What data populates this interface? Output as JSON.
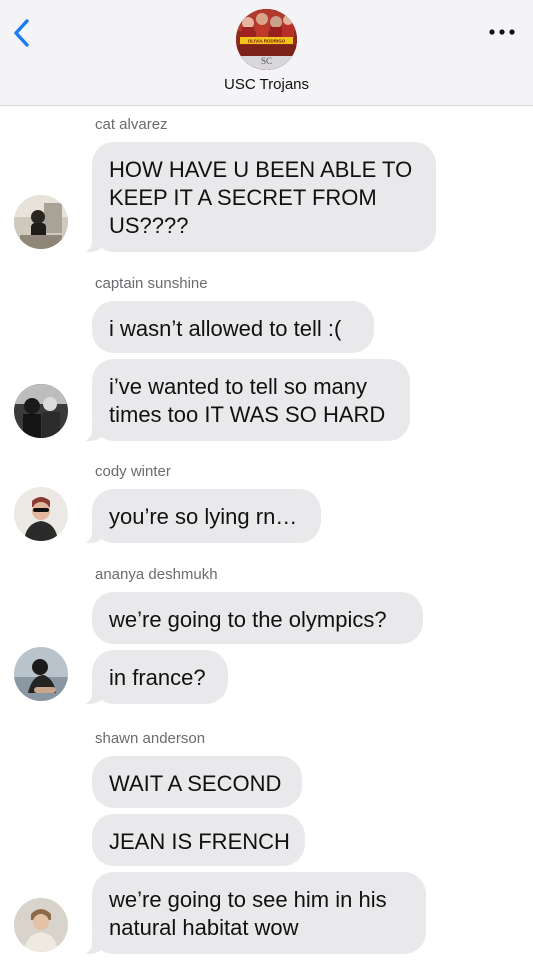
{
  "header": {
    "group_name": "USC Trojans",
    "group_avatar_text_top": "OLIVIA RODRIGO",
    "group_avatar_text_bottom": "SC",
    "back_icon": "chevron-left-icon",
    "more_icon": "ellipsis-icon",
    "accent_color": "#1a7cf5"
  },
  "messages": [
    {
      "sender": "cat alvarez",
      "bubbles": [
        [
          "HOW HAVE U BEEN ABLE TO",
          "KEEP IT A SECRET FROM",
          "US????"
        ]
      ]
    },
    {
      "sender": "captain sunshine",
      "bubbles": [
        [
          "i wasn’t allowed to tell :("
        ],
        [
          "i’ve wanted to tell so many",
          "times too IT WAS SO HARD"
        ]
      ]
    },
    {
      "sender": "cody winter",
      "bubbles": [
        [
          "you’re so lying rn…"
        ]
      ]
    },
    {
      "sender": "ananya deshmukh",
      "bubbles": [
        [
          "we’re going to the olympics?"
        ],
        [
          "in france?"
        ]
      ]
    },
    {
      "sender": "shawn anderson",
      "bubbles": [
        [
          "WAIT A SECOND"
        ],
        [
          "JEAN IS FRENCH"
        ],
        [
          "we’re going to see him in his",
          "natural habitat wow"
        ]
      ]
    }
  ],
  "colors": {
    "bubble_bg": "#e9e9eb",
    "sender_text": "#6b6b70",
    "header_bg": "#f4f4f6"
  }
}
